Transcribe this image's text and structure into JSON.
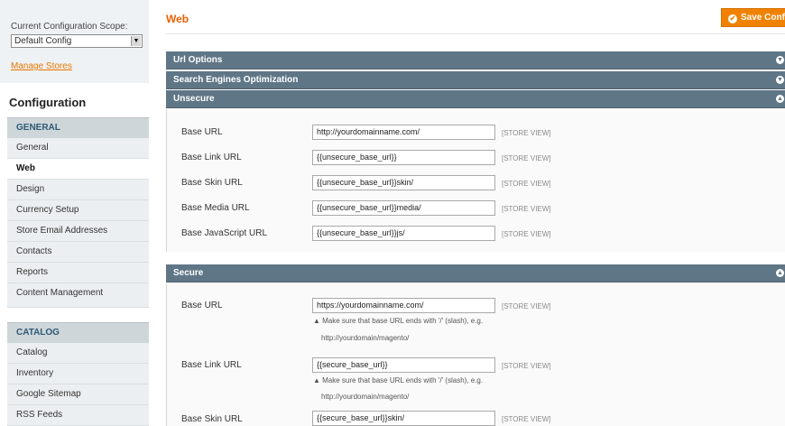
{
  "sidebar": {
    "scope_label": "Current Configuration Scope:",
    "scope_value": "Default Config",
    "manage_stores": "Manage Stores",
    "config_title": "Configuration",
    "sections": [
      {
        "title": "GENERAL",
        "items": [
          {
            "label": "General",
            "active": false
          },
          {
            "label": "Web",
            "active": true
          },
          {
            "label": "Design",
            "active": false
          },
          {
            "label": "Currency Setup",
            "active": false
          },
          {
            "label": "Store Email Addresses",
            "active": false
          },
          {
            "label": "Contacts",
            "active": false
          },
          {
            "label": "Reports",
            "active": false
          },
          {
            "label": "Content Management",
            "active": false
          }
        ]
      },
      {
        "title": "CATALOG",
        "items": [
          {
            "label": "Catalog",
            "active": false
          },
          {
            "label": "Inventory",
            "active": false
          },
          {
            "label": "Google Sitemap",
            "active": false
          },
          {
            "label": "RSS Feeds",
            "active": false
          }
        ]
      }
    ]
  },
  "main": {
    "title": "Web",
    "save_label": "Save Config",
    "sections": {
      "url_options": "Url Options",
      "seo": "Search Engines Optimization",
      "unsecure": "Unsecure",
      "secure": "Secure"
    },
    "unsecure_rows": [
      {
        "label": "Base URL",
        "value": "http://yourdomainname.com/",
        "scope": "[STORE VIEW]"
      },
      {
        "label": "Base Link URL",
        "value": "{{unsecure_base_url}}",
        "scope": "[STORE VIEW]"
      },
      {
        "label": "Base Skin URL",
        "value": "{{unsecure_base_url}}skin/",
        "scope": "[STORE VIEW]"
      },
      {
        "label": "Base Media URL",
        "value": "{{unsecure_base_url}}media/",
        "scope": "[STORE VIEW]"
      },
      {
        "label": "Base JavaScript URL",
        "value": "{{unsecure_base_url}}js/",
        "scope": "[STORE VIEW]"
      }
    ],
    "secure_rows": [
      {
        "label": "Base URL",
        "value": "https://yourdomainname.com/",
        "scope": "[STORE VIEW]",
        "note1": "▲ Make sure that base URL ends with '/' (slash), e.g.",
        "note2": "http://yourdomain/magento/"
      },
      {
        "label": "Base Link URL",
        "value": "{{secure_base_url}}",
        "scope": "[STORE VIEW]",
        "note1": "▲ Make sure that base URL ends with '/' (slash), e.g.",
        "note2": "http://yourdomain/magento/"
      },
      {
        "label": "Base Skin URL",
        "value": "{{secure_base_url}}skin/",
        "scope": "[STORE VIEW]"
      }
    ]
  },
  "colors": {
    "accent": "#eb5e00",
    "section_header": "#5f7686",
    "nav_heading": "#2d5a75"
  },
  "icons": {
    "save": "check-circle-icon",
    "collapse": "collapse-icon",
    "expand": "expand-icon",
    "select": "chevron-down-icon"
  }
}
